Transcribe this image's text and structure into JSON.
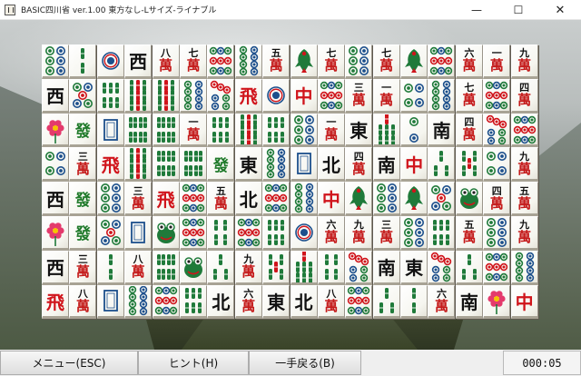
{
  "window": {
    "title": "BASIC四川省 ver.1.00 東方なし-Lサイズ-ライナブル",
    "minimize_glyph": "—",
    "maximize_glyph": "☐",
    "close_glyph": "✕"
  },
  "footer": {
    "menu_label": "メニュー(ESC)",
    "hint_label": "ヒント(H)",
    "undo_label": "一手戻る(B)",
    "timer": "000:05"
  },
  "colors": {
    "man_red": "#c41a1a",
    "dragon_red": "#d0141b",
    "dragon_green": "#1f7a2a",
    "dot_blue": "#1c4f8c",
    "bamboo_green": "#1f7a3a"
  },
  "board": {
    "rows": [
      [
        "p6",
        "b2",
        "p1",
        "西",
        "m8",
        "m7",
        "p9",
        "p8",
        "m5",
        "bird",
        "m7",
        "p6",
        "m7",
        "bird",
        "p9",
        "m6",
        "m1",
        "m9"
      ],
      [
        "西",
        "p5",
        "b6",
        "b9",
        "b9",
        "p8",
        "p7",
        "飛",
        "p1",
        "中",
        "p9",
        "m3",
        "m1",
        "p4",
        "p8",
        "m7",
        "p9",
        "m4"
      ],
      [
        "flower",
        "發",
        "白",
        "b8",
        "b8",
        "m1",
        "b6",
        "b9",
        "b6",
        "p6",
        "m1",
        "東",
        "b7",
        "p2",
        "南",
        "m4",
        "p7",
        "p9"
      ],
      [
        "p4",
        "m3",
        "飛",
        "b9",
        "b8",
        "b8",
        "發",
        "東",
        "p8",
        "白",
        "北",
        "m4",
        "南",
        "中",
        "b3",
        "b5",
        "p4",
        "m9"
      ],
      [
        "西",
        "發",
        "p6",
        "m3",
        "飛",
        "p9",
        "m5",
        "北",
        "p9",
        "p8",
        "中",
        "bird",
        "p6",
        "bird",
        "p5",
        "frog",
        "m4",
        "m5"
      ],
      [
        "flower",
        "發",
        "p5",
        "白",
        "frog",
        "p9",
        "b4",
        "p9",
        "b6",
        "p1",
        "m6",
        "m9",
        "m3",
        "p6",
        "b6",
        "m5",
        "p6",
        "m9"
      ],
      [
        "西",
        "m3",
        "b2",
        "m8",
        "b8",
        "frog",
        "b3",
        "m9",
        "b5",
        "b7",
        "b4",
        "p7",
        "南",
        "東",
        "p7",
        "b3",
        "p9",
        "p8"
      ],
      [
        "飛",
        "m8",
        "白",
        "p8",
        "p9",
        "b6",
        "北",
        "m6",
        "東",
        "北",
        "m8",
        "p9",
        "b3",
        "b2",
        "m6",
        "南",
        "flower",
        "中"
      ]
    ]
  }
}
